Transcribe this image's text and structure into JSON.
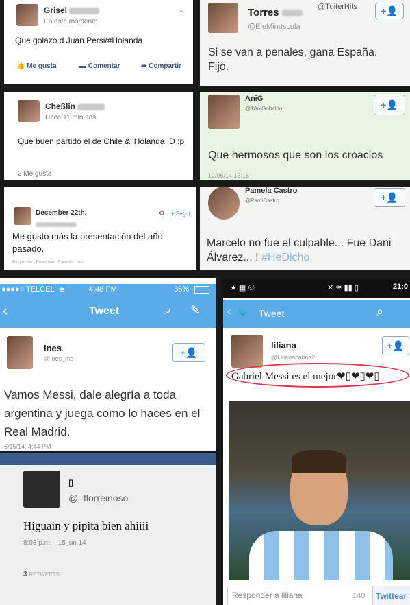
{
  "watermark": "@TuiterHits",
  "p1": {
    "name": "Grisel",
    "subtitle": "En este momento",
    "text": "Que golazo d Juan Persi/#Holanda",
    "like": "Me gusta",
    "comment": "Comentar",
    "share": "Compartir"
  },
  "p2": {
    "name": "Torres",
    "handle": "@EleMinuscula",
    "text": "Si se van a penales, gana España. Fijo."
  },
  "p3": {
    "name": "Cheßlin",
    "subtitle": "Hace 11 minutos",
    "text": "Que buen partido el de Chile &' Holanda :D :p",
    "likes": "2 Me gusta"
  },
  "p4": {
    "name": "AniG",
    "handle": "@1AniGabaldo",
    "text": "Que hermosos que son los croacios",
    "time": "12/06/14 13:16"
  },
  "p5": {
    "name": "December 22th.",
    "follow": "Segui",
    "text": "Me gusto más la presentación del año pasado.",
    "actions": "Responder · Retwittear · Favorito · Más"
  },
  "p6": {
    "name": "Pamela Castro",
    "handle": "@PamiCastro",
    "text": "Marcelo no fue el culpable... Fue Dani Álvarez... !",
    "hashtag": "#HeDicho"
  },
  "p7": {
    "carrier": "TELCEL",
    "time": "4:48 PM",
    "battery": "35%",
    "title": "Tweet",
    "name": "Ines",
    "handle": "@Ines_mc",
    "text": "Vamos Messi, dale alegría a toda argentina y juega como lo haces en el Real Madrid.",
    "date": "6/15/14, 4:44 PM"
  },
  "p8": {
    "clock": "21:0",
    "title": "Tweet",
    "name": "liliana",
    "handle": "@Lilianacabos2",
    "text": "Gabriel Messi es el mejor❤▯❤▯❤▯",
    "reply_placeholder": "Responder a liliana",
    "counter": "140",
    "tweet_button": "Twittear"
  },
  "p9": {
    "name": "▯",
    "handle": "@_florreinoso",
    "text": "Higuain y pipita bien ahiiii",
    "time": "8:03 p.m. · 15 jun 14",
    "retweets_count": "3",
    "retweets_label": "RETWEETS"
  },
  "icons": {
    "follow": "follow-user-icon",
    "search": "search-icon",
    "compose": "compose-icon",
    "back": "back-arrow-icon",
    "bird": "twitter-bird-icon"
  },
  "colors": {
    "twitter_blue": "#5aace8",
    "link_blue": "#4a8abf",
    "highlight_red": "#e0354a"
  }
}
